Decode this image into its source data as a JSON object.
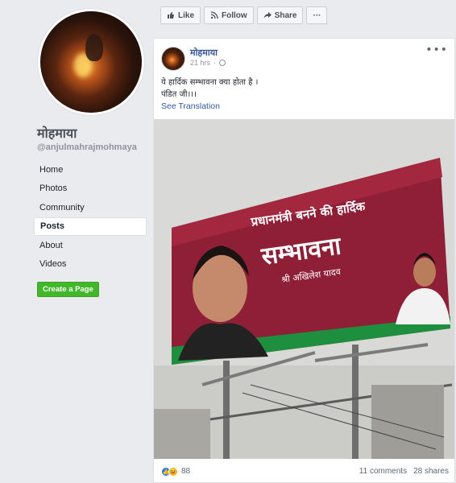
{
  "sidebar": {
    "page_name": "मोहमाया",
    "handle": "@anjulmahrajmohmaya",
    "nav": [
      {
        "label": "Home"
      },
      {
        "label": "Photos"
      },
      {
        "label": "Community"
      },
      {
        "label": "Posts"
      },
      {
        "label": "About"
      },
      {
        "label": "Videos"
      }
    ],
    "active_nav": "Posts",
    "create_page_label": "Create a Page"
  },
  "actions": {
    "like": "Like",
    "follow": "Follow",
    "share": "Share",
    "more": "···"
  },
  "post": {
    "author": "मोहमाया",
    "time": "21 hrs",
    "text_line1": "ये हार्दिक सम्भावना क्या होता है ।",
    "text_line2": "पंडित जी।।।",
    "see_translation": "See Translation",
    "menu": "•••",
    "billboard": {
      "line1": "प्रधानमंत्री बनने की हार्दिक",
      "line2": "सम्भावना",
      "line3": "श्री अखिलेश यादव"
    },
    "reactions_count": "88",
    "comments": "11 comments",
    "shares": "28 shares"
  },
  "colors": {
    "link": "#365899",
    "green_button": "#42b72a",
    "background": "#e9ebee"
  }
}
